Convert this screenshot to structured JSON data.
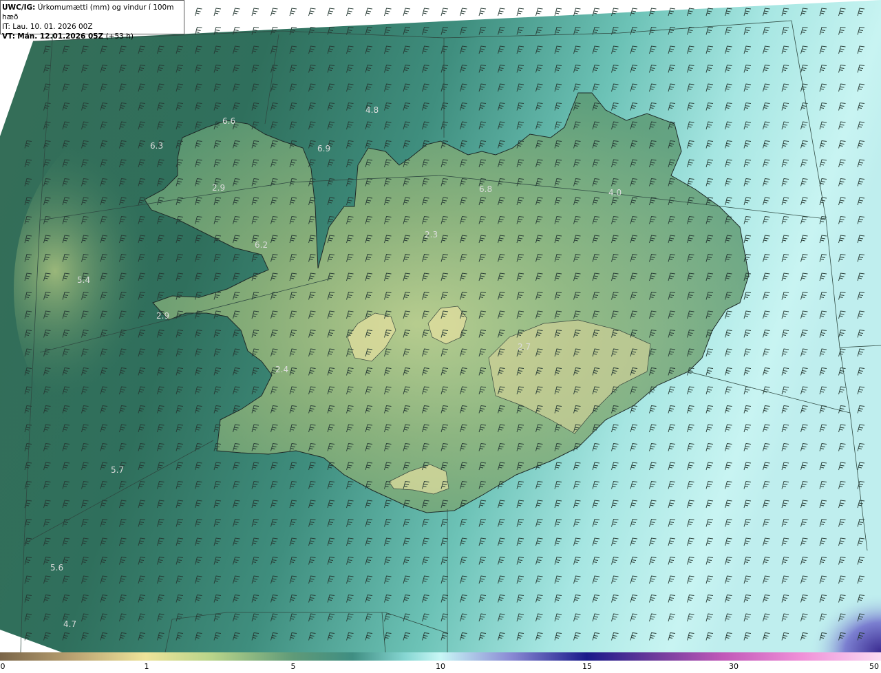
{
  "header": {
    "model": "UWC/IG:",
    "title": "Úrkomumætti (mm) og vindur í 100m hæð",
    "it_line": "IT: Lau. 10. 01. 2026 00Z",
    "vt_prefix": "VT:",
    "vt_time": "Mán. 12.01.2026 05Z",
    "vt_lead": "(+53 h)"
  },
  "values": [
    "4.8",
    "6.6",
    "6.3",
    "6.9",
    "2.9",
    "6.8",
    "4.0",
    "2.3",
    "6.2",
    "5.4",
    "2.9",
    "2.7",
    "2.4",
    "5.7",
    "5.6",
    "4.7"
  ],
  "colorbar": {
    "ticks": [
      "0",
      "1",
      "5",
      "10",
      "15",
      "30",
      "50"
    ],
    "colors": [
      "#7a6548",
      "#eee49a",
      "#5f9a78",
      "#c9f7f6",
      "#1a1a8a",
      "#c058b8",
      "#fbdaf2"
    ]
  },
  "colors": {
    "land_outline": "#1e2a28",
    "grid_line": "#2f4a42",
    "barb": "#263a34",
    "sea_dark": "#2f6f5c",
    "sea_light": "#c9f4f0"
  },
  "icons": {
    "wind_barb": "wind-barb-icon"
  }
}
